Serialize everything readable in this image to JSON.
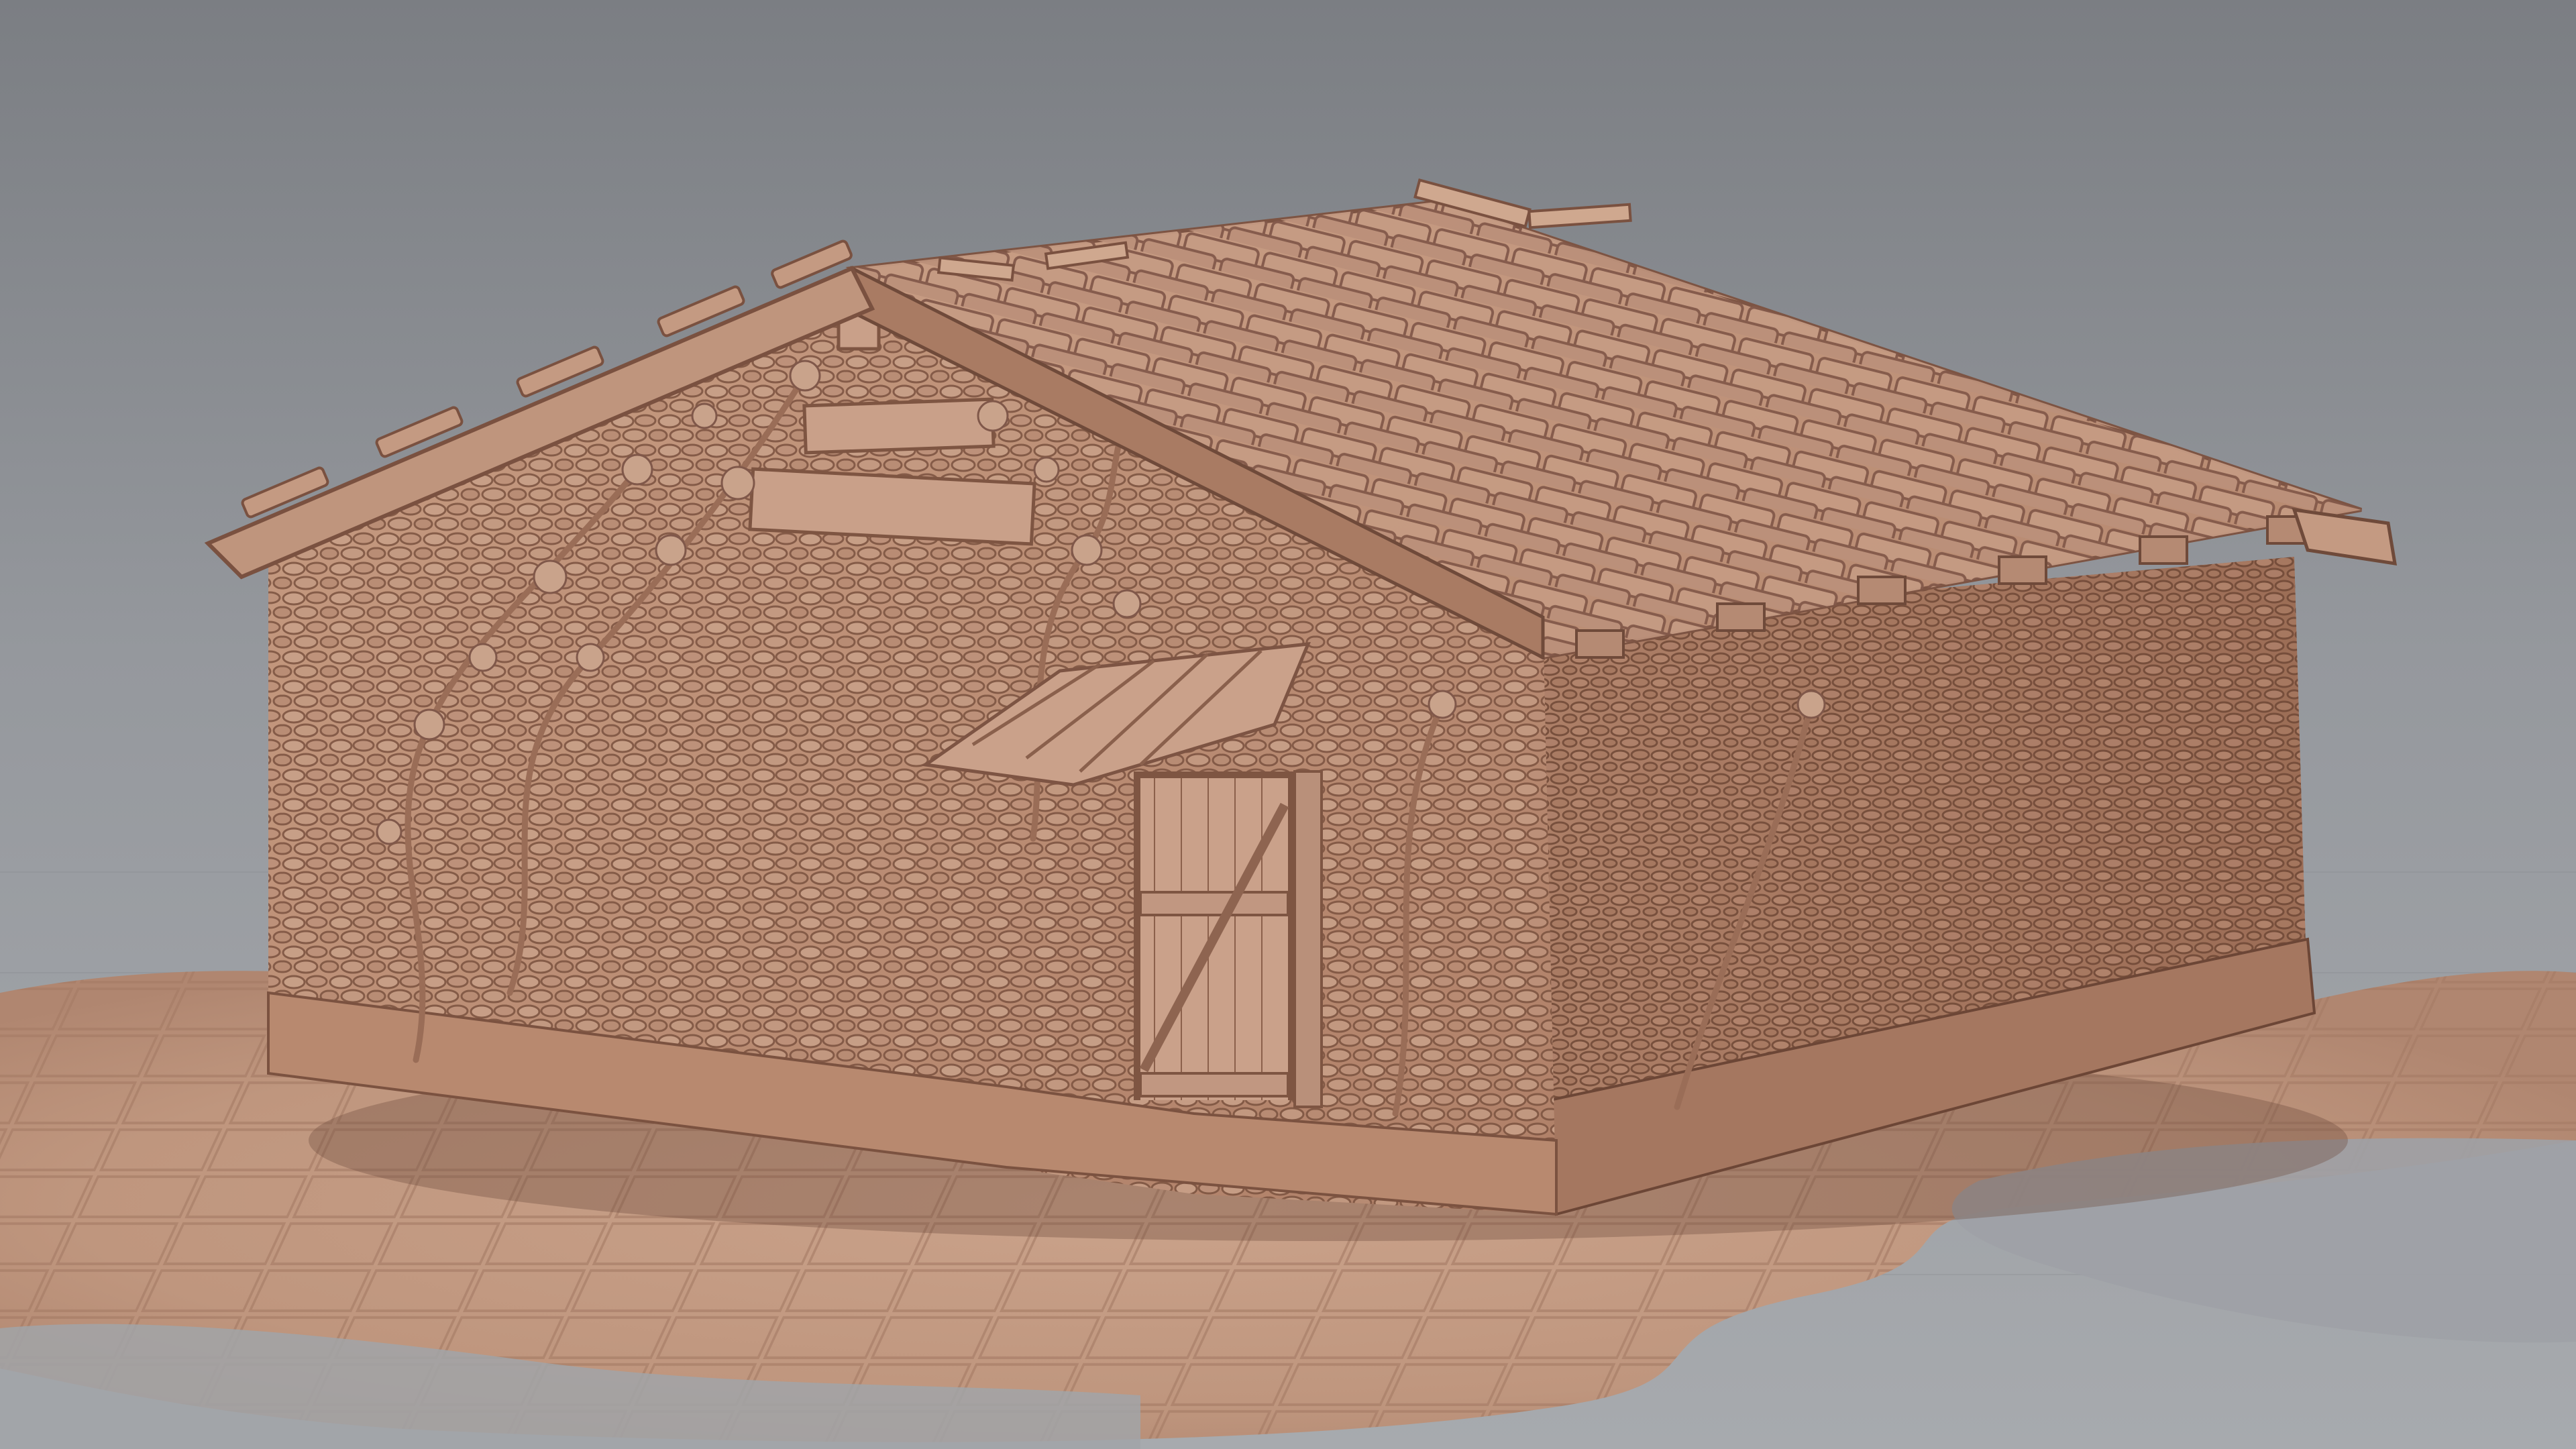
{
  "scene": {
    "subject": "stone-hut-clay-render",
    "colors": {
      "background_top": "#7d8085",
      "background_mid": "#979a9f",
      "background_bottom": "#a3a6ab",
      "clay_light": "#cda48c",
      "clay_mid": "#b8876d",
      "clay_dark": "#8a5f49",
      "clay_shadow": "#6b4535",
      "ground_clay": "#c49a82"
    }
  }
}
